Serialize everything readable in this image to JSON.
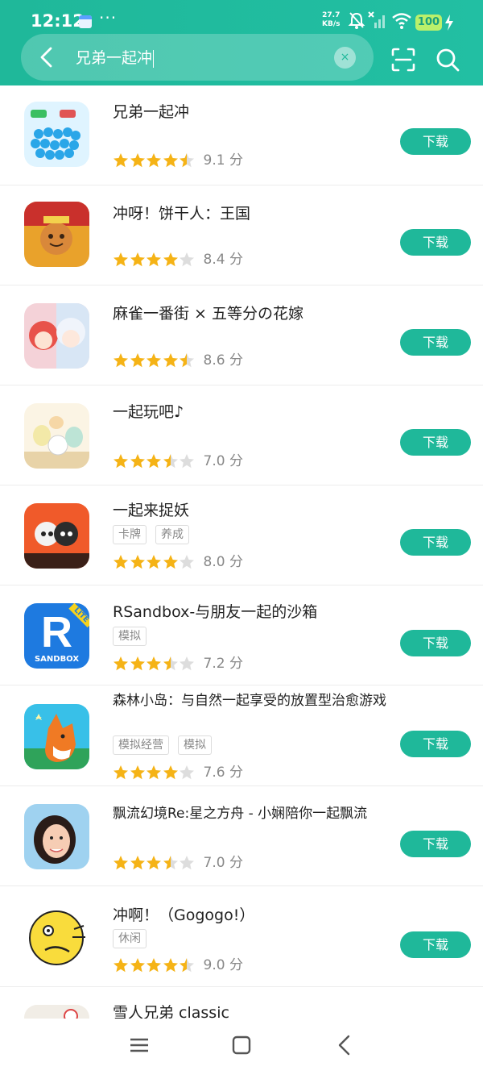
{
  "status_bar": {
    "time": "12:12",
    "more": "···",
    "net_speed_value": "27.7",
    "net_speed_unit": "KB/s",
    "battery": "100"
  },
  "search": {
    "query": "兄弟一起冲",
    "clear_label": "×"
  },
  "colors": {
    "accent": "#1fb89a",
    "star": "#f5b316",
    "star_empty": "#dddddd"
  },
  "results": [
    {
      "title": "兄弟一起冲",
      "tags": [],
      "rating": 4.5,
      "score": "9.1 分",
      "action": "下载",
      "icon": "crowd-runner-app-icon"
    },
    {
      "title": "冲呀！饼干人：王国",
      "tags": [],
      "rating": 4,
      "score": "8.4 分",
      "action": "下载",
      "icon": "cookie-kingdom-app-icon"
    },
    {
      "title": "麻雀一番街 × 五等分の花嫁",
      "tags": [],
      "rating": 4.5,
      "score": "8.6 分",
      "action": "下载",
      "icon": "mahjong-anime-app-icon"
    },
    {
      "title": "一起玩吧♪",
      "tags": [],
      "rating": 3.5,
      "score": "7.0 分",
      "action": "下载",
      "icon": "sumikko-app-icon"
    },
    {
      "title": "一起来捉妖",
      "tags": [
        "卡牌",
        "养成"
      ],
      "rating": 4,
      "score": "8.0 分",
      "action": "下载",
      "icon": "catch-monster-app-icon"
    },
    {
      "title": "RSandbox-与朋友一起的沙箱",
      "tags": [
        "模拟"
      ],
      "rating": 3.5,
      "score": "7.2 分",
      "action": "下载",
      "icon": "rsandbox-app-icon",
      "icon_text": "R",
      "icon_badge": "LITE",
      "icon_caption": "SANDBOX"
    },
    {
      "title": "森林小岛：与自然一起享受的放置型治愈游戏",
      "tags": [
        "模拟经营",
        "模拟"
      ],
      "rating": 4,
      "score": "7.6 分",
      "action": "下载",
      "icon": "fox-forest-app-icon"
    },
    {
      "title": "飘流幻境Re:星之方舟 - 小娴陪你一起飘流",
      "tags": [],
      "rating": 3.5,
      "score": "7.0 分",
      "action": "下载",
      "icon": "girl-portrait-app-icon"
    },
    {
      "title": "冲啊！（Gogogo!）",
      "tags": [
        "休闲"
      ],
      "rating": 4.5,
      "score": "9.0 分",
      "action": "下载",
      "icon": "yellow-face-app-icon"
    },
    {
      "title": "雪人兄弟 classic",
      "tags": [],
      "rating": 0,
      "score": "",
      "action": "",
      "icon": "snow-bros-app-icon"
    }
  ],
  "nav": [
    "menu-icon",
    "home-icon",
    "back-icon"
  ]
}
